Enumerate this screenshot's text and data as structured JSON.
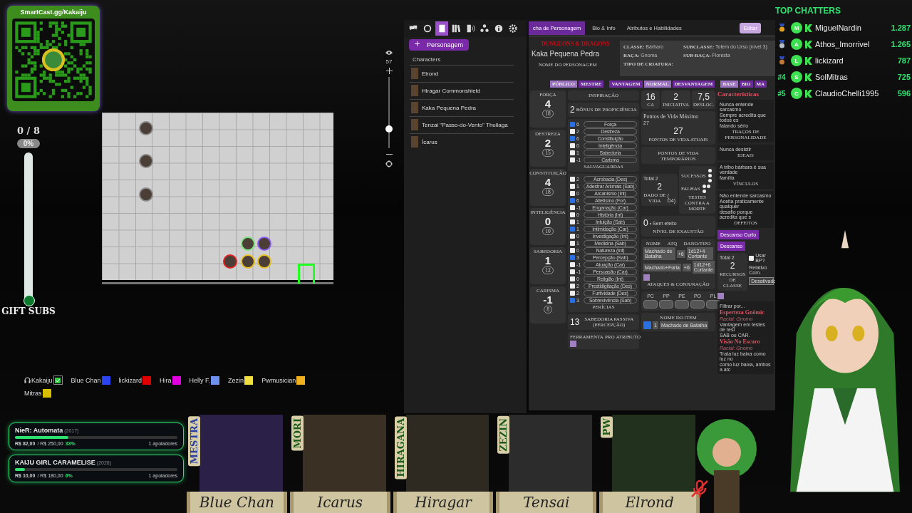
{
  "qr_card": {
    "title": "SmartCast.gg/Kakaiju"
  },
  "gift_subs": {
    "count": "0 / 8",
    "percent": "0%",
    "level": 0,
    "label": "GIFT SUBS"
  },
  "map": {
    "tokens": [
      {
        "color": "#8a8a8a"
      },
      {
        "color": "#8a8a8a"
      },
      {
        "color": "#8a8a8a"
      },
      {
        "color": "#7be07b"
      },
      {
        "color": "#8a5cf0"
      },
      {
        "color": "#e02020"
      },
      {
        "color": "#e8c020"
      },
      {
        "color": "#e8c020"
      }
    ]
  },
  "map_zoom": {
    "value": "57",
    "level": 0.25
  },
  "sidebar": {
    "tools": [
      {
        "selected": false
      },
      {
        "selected": false
      },
      {
        "selected": true
      },
      {
        "selected": false
      },
      {
        "selected": false
      },
      {
        "selected": false
      },
      {
        "selected": false
      },
      {
        "selected": false
      }
    ],
    "add_button": "Personagem",
    "section": "Characters",
    "characters": [
      {
        "name": "Elrond"
      },
      {
        "name": "Hiragar Commonshield"
      },
      {
        "name": "Kaka Pequena Pedra"
      },
      {
        "name": "Tenzai \"Passo-do-Vento\" Thuliaga"
      },
      {
        "name": "Ícarus"
      }
    ]
  },
  "sheet": {
    "tabs": [
      {
        "label": "cha de Personagem",
        "selected": true
      },
      {
        "label": "Bio & Info",
        "selected": false
      },
      {
        "label": "Atributos e Habilidades",
        "selected": false
      }
    ],
    "edit_button": "Editar",
    "logo": "DUNGEONS & DRAGONS",
    "character_name": "Kaka Pequena Pedra",
    "name_caption": "NOME DO PERSONAGEM",
    "details": [
      {
        "label": "CLASSE:",
        "value": "Bárbaro"
      },
      {
        "label": "SUBCLASSE:",
        "value": "Totem do Urso (nível 3)"
      },
      {
        "label": "RAÇA:",
        "value": "Gnoma"
      },
      {
        "label": "SUB-RAÇA:",
        "value": "Floresta"
      },
      {
        "label": "TIPO DE CRIATURA:"
      }
    ],
    "roll_toggles": [
      {
        "label": "PÚBLICO",
        "selected": true
      },
      {
        "label": "MESTRE",
        "selected": false
      },
      {
        "label": "VANTAGEM",
        "selected": false
      },
      {
        "label": "NORMAL",
        "selected": true
      },
      {
        "label": "DESVANTAGEM",
        "selected": false
      },
      {
        "label": "BASE",
        "selected": true
      },
      {
        "label": "BIO",
        "selected": false
      },
      {
        "label": "MA",
        "selected": false
      }
    ],
    "abilities": [
      {
        "name": "FORÇA",
        "modifier": "4",
        "score": "18"
      },
      {
        "name": "DESTREZA",
        "modifier": "2",
        "score": "15"
      },
      {
        "name": "CONSTITUIÇÃO",
        "modifier": "4",
        "score": "18"
      },
      {
        "name": "INTELIGÊNCIA",
        "modifier": "0",
        "score": "10"
      },
      {
        "name": "SABEDORIA",
        "modifier": "1",
        "score": "12"
      },
      {
        "name": "CARISMA",
        "modifier": "-1",
        "score": "8"
      }
    ],
    "inspiration": "INSPIRAÇÃO",
    "proficiency": {
      "value": "2",
      "label": "BÔNUS DE PROFICIÊNCIA"
    },
    "saves": [
      {
        "value": "6",
        "name": "Força",
        "checked": true
      },
      {
        "value": "2",
        "name": "Destreza",
        "checked": false
      },
      {
        "value": "6",
        "name": "Constituição",
        "checked": true
      },
      {
        "value": "0",
        "name": "Inteligência",
        "checked": false
      },
      {
        "value": "1",
        "name": "Sabedoria",
        "checked": false
      },
      {
        "value": "-1",
        "name": "Carisma",
        "checked": false
      }
    ],
    "saves_label": "SALVAGUARDAS",
    "skills": [
      {
        "value": "2",
        "name": "Acrobacia (Des)",
        "checked": false
      },
      {
        "value": "1",
        "name": "Adestrar Animais (Sab)",
        "checked": false
      },
      {
        "value": "0",
        "name": "Arcanismo (Int)",
        "checked": false
      },
      {
        "value": "6",
        "name": "Atletismo (For)",
        "checked": true
      },
      {
        "value": "-1",
        "name": "Enganação (Car)",
        "checked": false
      },
      {
        "value": "0",
        "name": "História (Int)",
        "checked": false
      },
      {
        "value": "1",
        "name": "Intuição (Sab)",
        "checked": false
      },
      {
        "value": "1",
        "name": "Intimidação (Car)",
        "checked": true
      },
      {
        "value": "0",
        "name": "Investigação (Int)",
        "checked": false
      },
      {
        "value": "1",
        "name": "Medicina (Sab)",
        "checked": false
      },
      {
        "value": "0",
        "name": "Natureza (Int)",
        "checked": false
      },
      {
        "value": "3",
        "name": "Percepção (Sab)",
        "checked": true
      },
      {
        "value": "-1",
        "name": "Atuação (Car)",
        "checked": false
      },
      {
        "value": "-1",
        "name": "Persuasão (Car)",
        "checked": false
      },
      {
        "value": "0",
        "name": "Religião (Int)",
        "checked": false
      },
      {
        "value": "2",
        "name": "Prestidigitação (Des)",
        "checked": false
      },
      {
        "value": "2",
        "name": "Furtividade (Des)",
        "checked": false
      },
      {
        "value": "3",
        "name": "Sobrevivência (Sab)",
        "checked": true
      }
    ],
    "skills_label": "PERÍCIAS",
    "passive": {
      "value": "13",
      "label": "SABEDORIA PASSIVA (PERCEPÇÃO)"
    },
    "tools_headers": [
      "FERRAMENTA",
      "PRO",
      "ATRIBUTO"
    ],
    "combat": [
      {
        "value": "16",
        "label": "CA"
      },
      {
        "value": "2",
        "label": "INICIATIVA"
      },
      {
        "value": "7,5",
        "label": "DESLOC."
      }
    ],
    "hp": {
      "max_label": "Pontos de Vida Máximo",
      "max": "27",
      "current": "27",
      "current_label": "PONTOS DE VIDA ATUAIS",
      "temp_label": "PONTOS DE VIDA TEMPORÁRIOS"
    },
    "hit_dice": {
      "total_label": "Total",
      "total": "2",
      "value": "2",
      "label": "DADO DE VIDA",
      "die": "( D4)"
    },
    "death_saves": {
      "successes_label": "SUCESSOS",
      "failures_label": "FALHAS",
      "label": "TESTES CONTRA A MORTE"
    },
    "exhaustion": {
      "value": "0",
      "effect": "• Sem efeito",
      "label": "NÍVEL DE EXAUSTÃO"
    },
    "attacks": {
      "headers": [
        "NOME",
        "ATQ",
        "DANO/TIPO"
      ],
      "rows": [
        {
          "name": "Machado de Batalha",
          "bonus": "+6",
          "damage": "1d12+4 Cortante"
        },
        {
          "name": "Machado+Fúria",
          "bonus": "+6",
          "damage": "1d12+6 Cortante"
        }
      ],
      "label": "ATAQUES & CONJURAÇÃO"
    },
    "coins": [
      "PC",
      "PP",
      "PE",
      "PO",
      "PL"
    ],
    "items": {
      "header": "NOME DO ITEM",
      "rows": [
        {
          "qty": "1",
          "name": "Machado de Batalha",
          "equipped": true
        }
      ]
    },
    "traits_title": "Características",
    "traits": [
      {
        "lines": [
          "Nunca entende sarcasmo",
          "Sempre acredita que todos es",
          "falando sério"
        ],
        "label": "TRAÇOS DE PERSONALIDADE"
      },
      {
        "lines": [
          "Nunca desistir"
        ],
        "label": "IDEAIS"
      },
      {
        "lines": [
          "A tribo bárbara é sua verdade",
          "família"
        ],
        "label": "VÍNCULOS"
      },
      {
        "lines": [
          "Não entende sarcasmo",
          "Aceita praticamente qualquer",
          "desafio porque acredita que s"
        ],
        "label": "DEFEITOS"
      }
    ],
    "rest_buttons": [
      "Descanso Curto",
      "Descanso"
    ],
    "class_resource": {
      "total_label": "Total",
      "total": "2",
      "value": "2",
      "label": "RECURSOS DE CLASSE",
      "use_bp": "Usar BP?",
      "use_bp_checked": false,
      "relative_label": "Relativo Com.",
      "relative_value": "Desativado"
    },
    "features": {
      "filter": "Filtrar por...",
      "items": [
        {
          "title": "Esperteza Gnômic",
          "source": "Racial: Gnomo",
          "lines": [
            "Vantagem em testes de resi",
            "SAB ou CAR."
          ]
        },
        {
          "title": "Visão No Escuro",
          "source": "Racial: Gnomo",
          "lines": [
            "Trata luz baixa como luz no",
            "como luz baixa, ambos a atc"
          ]
        }
      ]
    }
  },
  "top_chatters": {
    "title": "TOP CHATTERS",
    "rows": [
      {
        "kind": "medal",
        "color": "#e0a020",
        "initial": "M",
        "name": "MiguelNardin",
        "count": "1.287"
      },
      {
        "kind": "medal",
        "color": "#b8c0cc",
        "initial": "A",
        "name": "Athos_Imorrivel",
        "count": "1.265"
      },
      {
        "kind": "medal",
        "color": "#c07838",
        "initial": "L",
        "name": "lickizard",
        "count": "787"
      },
      {
        "kind": "rank",
        "rank": "#4",
        "initial": "S",
        "name": "SolMitras",
        "count": "725"
      },
      {
        "kind": "rank",
        "rank": "#5",
        "initial": "C",
        "name": "ClaudioChelli1995",
        "count": "596"
      }
    ]
  },
  "voice": [
    {
      "kind": "check",
      "name": "Kakaiju",
      "color": "#2ecc40"
    },
    {
      "kind": "swatch",
      "name": "Blue Chan",
      "color": "#2b44f0"
    },
    {
      "kind": "swatch",
      "name": "lickizard",
      "color": "#e00000"
    },
    {
      "kind": "swatch",
      "name": "Hira",
      "color": "#e000e0"
    },
    {
      "kind": "swatch",
      "name": "Helly F.",
      "color": "#7090f0"
    },
    {
      "kind": "swatch",
      "name": "Zezin",
      "color": "#f0e040"
    },
    {
      "kind": "swatch",
      "name": "Pwmusician",
      "color": "#f0b020"
    },
    {
      "kind": "swatch",
      "name": "Mitras",
      "color": "#d8c000"
    }
  ],
  "goals": [
    {
      "title": "NieR: Automata",
      "year": "(2017)",
      "level": 0.33,
      "raised": "R$ 82,00",
      "target": "/ R$ 250,00",
      "percent": "33%",
      "backers": "1 apoiadores"
    },
    {
      "title": "KAIJU GIRL CARAMELISE",
      "year": "(2026)",
      "level": 0.06,
      "raised": "R$ 10,00",
      "target": "/ R$ 180,00",
      "percent": "6%",
      "backers": "1 apoiadores"
    }
  ],
  "party": [
    {
      "role": "MESTRA",
      "name": "Blue Chan"
    },
    {
      "role": "MORI",
      "name": "Icarus"
    },
    {
      "role": "HIRAGANA",
      "name": "Hiragar"
    },
    {
      "role": "ZEZIN",
      "name": "Tensai"
    },
    {
      "role": "PW",
      "name": "Elrond"
    }
  ]
}
